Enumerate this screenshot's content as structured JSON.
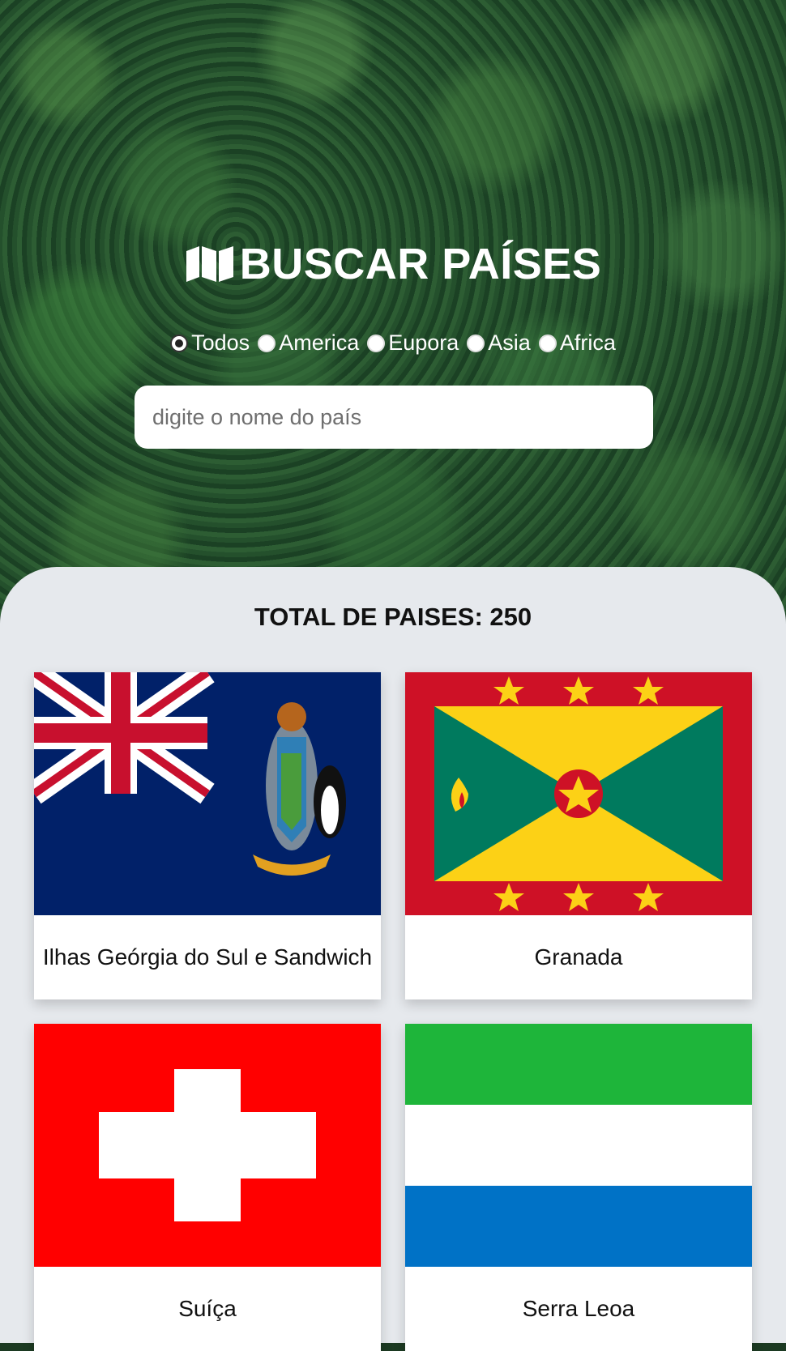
{
  "header": {
    "title": "BUSCAR PAÍSES",
    "icon": "map-icon"
  },
  "filters": {
    "options": [
      {
        "label": "Todos",
        "checked": true
      },
      {
        "label": "America",
        "checked": false
      },
      {
        "label": "Eupora",
        "checked": false
      },
      {
        "label": "Asia",
        "checked": false
      },
      {
        "label": "Africa",
        "checked": false
      }
    ]
  },
  "search": {
    "placeholder": "digite o nome do país",
    "value": ""
  },
  "results": {
    "total_label": "TOTAL DE PAISES: 250",
    "countries": [
      {
        "name": "Ilhas Geórgia do Sul e Sandwich",
        "flag": "south-georgia-flag"
      },
      {
        "name": "Granada",
        "flag": "grenada-flag"
      },
      {
        "name": "Suíça",
        "flag": "switzerland-flag"
      },
      {
        "name": "Serra Leoa",
        "flag": "sierra-leone-flag"
      }
    ]
  },
  "colors": {
    "panel_bg": "#e6e9ed",
    "forest": "#1f4527"
  }
}
